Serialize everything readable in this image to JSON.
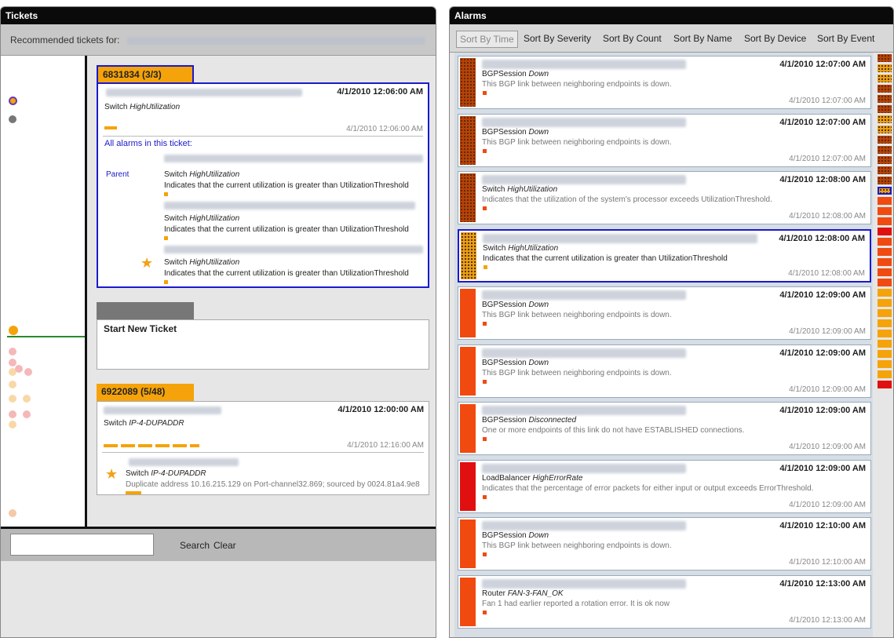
{
  "tickets_panel": {
    "title": "Tickets",
    "recommended_label": "Recommended tickets for:",
    "tickets": [
      {
        "header": "6831834 (3/3)",
        "time_bold": "4/1/2010 12:06:00 AM",
        "summary_prefix": "Switch ",
        "summary_event": "HighUtilization",
        "time_gray": "4/1/2010 12:06:00 AM",
        "all_alarms_label": "All alarms in this ticket:",
        "parent_label": "Parent",
        "alarms": [
          {
            "type_prefix": "Switch ",
            "type_event": "HighUtilization",
            "desc": "Indicates that the current utilization is greater than UtilizationThreshold"
          },
          {
            "type_prefix": "Switch ",
            "type_event": "HighUtilization",
            "desc": "Indicates that the current utilization is greater than UtilizationThreshold"
          },
          {
            "type_prefix": "Switch ",
            "type_event": "HighUtilization",
            "desc": "Indicates that the current utilization is greater than UtilizationThreshold"
          }
        ]
      },
      {
        "header": "6922089 (5/48)",
        "time_bold": "4/1/2010 12:00:00 AM",
        "summary_prefix": "Switch ",
        "summary_event": "IP-4-DUPADDR",
        "time_gray": "4/1/2010 12:16:00 AM",
        "child_prefix": "Switch ",
        "child_event": "IP-4-DUPADDR",
        "child_desc": "Duplicate address 10.16.215.129 on Port-channel32.869; sourced by 0024.81a4.9e8"
      }
    ],
    "new_ticket_label": "Start New Ticket",
    "search": {
      "placeholder": "",
      "search_label": "Search",
      "clear_label": "Clear"
    }
  },
  "alarms_panel": {
    "title": "Alarms",
    "sort_buttons": [
      "Sort By Time",
      "Sort By Severity",
      "Sort By Count",
      "Sort By Name",
      "Sort By Device",
      "Sort By Event"
    ],
    "active_sort": "Sort By Time",
    "alarms": [
      {
        "time": "4/1/2010 12:07:00 AM",
        "type": "BGPSession ",
        "event": "Down",
        "desc": "This BGP link between neighboring endpoints is down.",
        "time2": "4/1/2010 12:07:00 AM",
        "color": "#b8420a",
        "grid": true,
        "desc_dark": false
      },
      {
        "time": "4/1/2010 12:07:00 AM",
        "type": "BGPSession ",
        "event": "Down",
        "desc": "This BGP link between neighboring endpoints is down.",
        "time2": "4/1/2010 12:07:00 AM",
        "color": "#b8420a",
        "grid": true,
        "desc_dark": false
      },
      {
        "time": "4/1/2010 12:08:00 AM",
        "type": "Switch ",
        "event": "HighUtilization",
        "desc": "Indicates that the utilization of the system's processor exceeds UtilizationThreshold.",
        "time2": "4/1/2010 12:08:00 AM",
        "color": "#b8420a",
        "grid": true,
        "desc_dark": false
      },
      {
        "time": "4/1/2010 12:08:00 AM",
        "type": "Switch ",
        "event": "HighUtilization",
        "desc": "Indicates that the current utilization is greater than UtilizationThreshold",
        "time2": "4/1/2010 12:08:00 AM",
        "color": "#e8a11a",
        "grid": true,
        "desc_dark": true,
        "selected": true
      },
      {
        "time": "4/1/2010 12:09:00 AM",
        "type": "BGPSession ",
        "event": "Down",
        "desc": "This BGP link between neighboring endpoints is down.",
        "time2": "4/1/2010 12:09:00 AM",
        "color": "#f04a10",
        "grid": false,
        "desc_dark": false
      },
      {
        "time": "4/1/2010 12:09:00 AM",
        "type": "BGPSession ",
        "event": "Down",
        "desc": "This BGP link between neighboring endpoints is down.",
        "time2": "4/1/2010 12:09:00 AM",
        "color": "#f04a10",
        "grid": false,
        "desc_dark": false
      },
      {
        "time": "4/1/2010 12:09:00 AM",
        "type": "BGPSession ",
        "event": "Disconnected",
        "desc": "One or more endpoints of this link do not have ESTABLISHED connections.",
        "time2": "4/1/2010 12:09:00 AM",
        "color": "#f04a10",
        "grid": false,
        "desc_dark": false
      },
      {
        "time": "4/1/2010 12:09:00 AM",
        "type": "LoadBalancer ",
        "event": "HighErrorRate",
        "desc": "Indicates that the percentage of error packets for either input or output exceeds ErrorThreshold.",
        "time2": "4/1/2010 12:09:00 AM",
        "color": "#e01010",
        "grid": false,
        "desc_dark": false
      },
      {
        "time": "4/1/2010 12:10:00 AM",
        "type": "BGPSession ",
        "event": "Down",
        "desc": "This BGP link between neighboring endpoints is down.",
        "time2": "4/1/2010 12:10:00 AM",
        "color": "#f04a10",
        "grid": false,
        "desc_dark": false
      },
      {
        "time": "4/1/2010 12:13:00 AM",
        "type": "Router ",
        "event": "FAN-3-FAN_OK",
        "desc": "Fan 1 had earlier reported a rotation error. It is ok now",
        "time2": "4/1/2010 12:13:00 AM",
        "color": "#f04a10",
        "grid": false,
        "desc_dark": false
      }
    ]
  },
  "colors": {
    "accent_orange": "#f5a30a",
    "selection_blue": "#1a1acc",
    "panel_header": "#0a0a0a",
    "timeline_green": "#2a8a2a"
  }
}
